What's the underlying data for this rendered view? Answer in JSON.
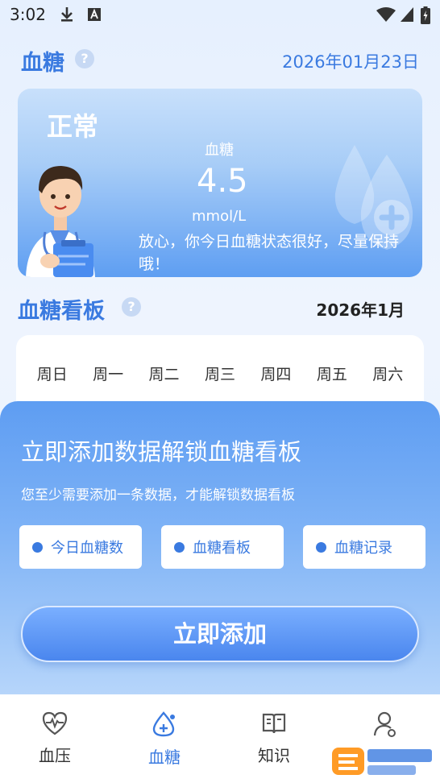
{
  "status_bar": {
    "time": "3:02",
    "icons": [
      "download-icon",
      "font-a-icon",
      "wifi-icon",
      "signal-icon",
      "battery-icon"
    ]
  },
  "header": {
    "title": "血糖",
    "date": "2026年01月23日"
  },
  "status_card": {
    "status": "正常",
    "label": "血糖",
    "value": "4.5",
    "unit": "mmol/L",
    "message": "放心，你今日血糖状态很好，尽量保持哦！"
  },
  "board": {
    "title": "血糖看板",
    "month": "2026年1月",
    "weekdays": [
      "周日",
      "周一",
      "周二",
      "周三",
      "周四",
      "周五",
      "周六"
    ]
  },
  "unlock_sheet": {
    "title": "立即添加数据解锁血糖看板",
    "subtitle": "您至少需要添加一条数据，才能解锁数据看板",
    "features": [
      "今日血糖数",
      "血糖看板",
      "血糖记录"
    ],
    "add_button": "立即添加"
  },
  "tab_bar": {
    "tabs": [
      {
        "label": "血压",
        "icon": "heart-pulse-icon"
      },
      {
        "label": "血糖",
        "icon": "blood-drop-plus-icon",
        "active": true
      },
      {
        "label": "知识",
        "icon": "book-icon"
      },
      {
        "label": "",
        "icon": "user-icon"
      }
    ]
  },
  "colors": {
    "accent": "#3a7ae0",
    "tab_inactive": "#333333"
  }
}
